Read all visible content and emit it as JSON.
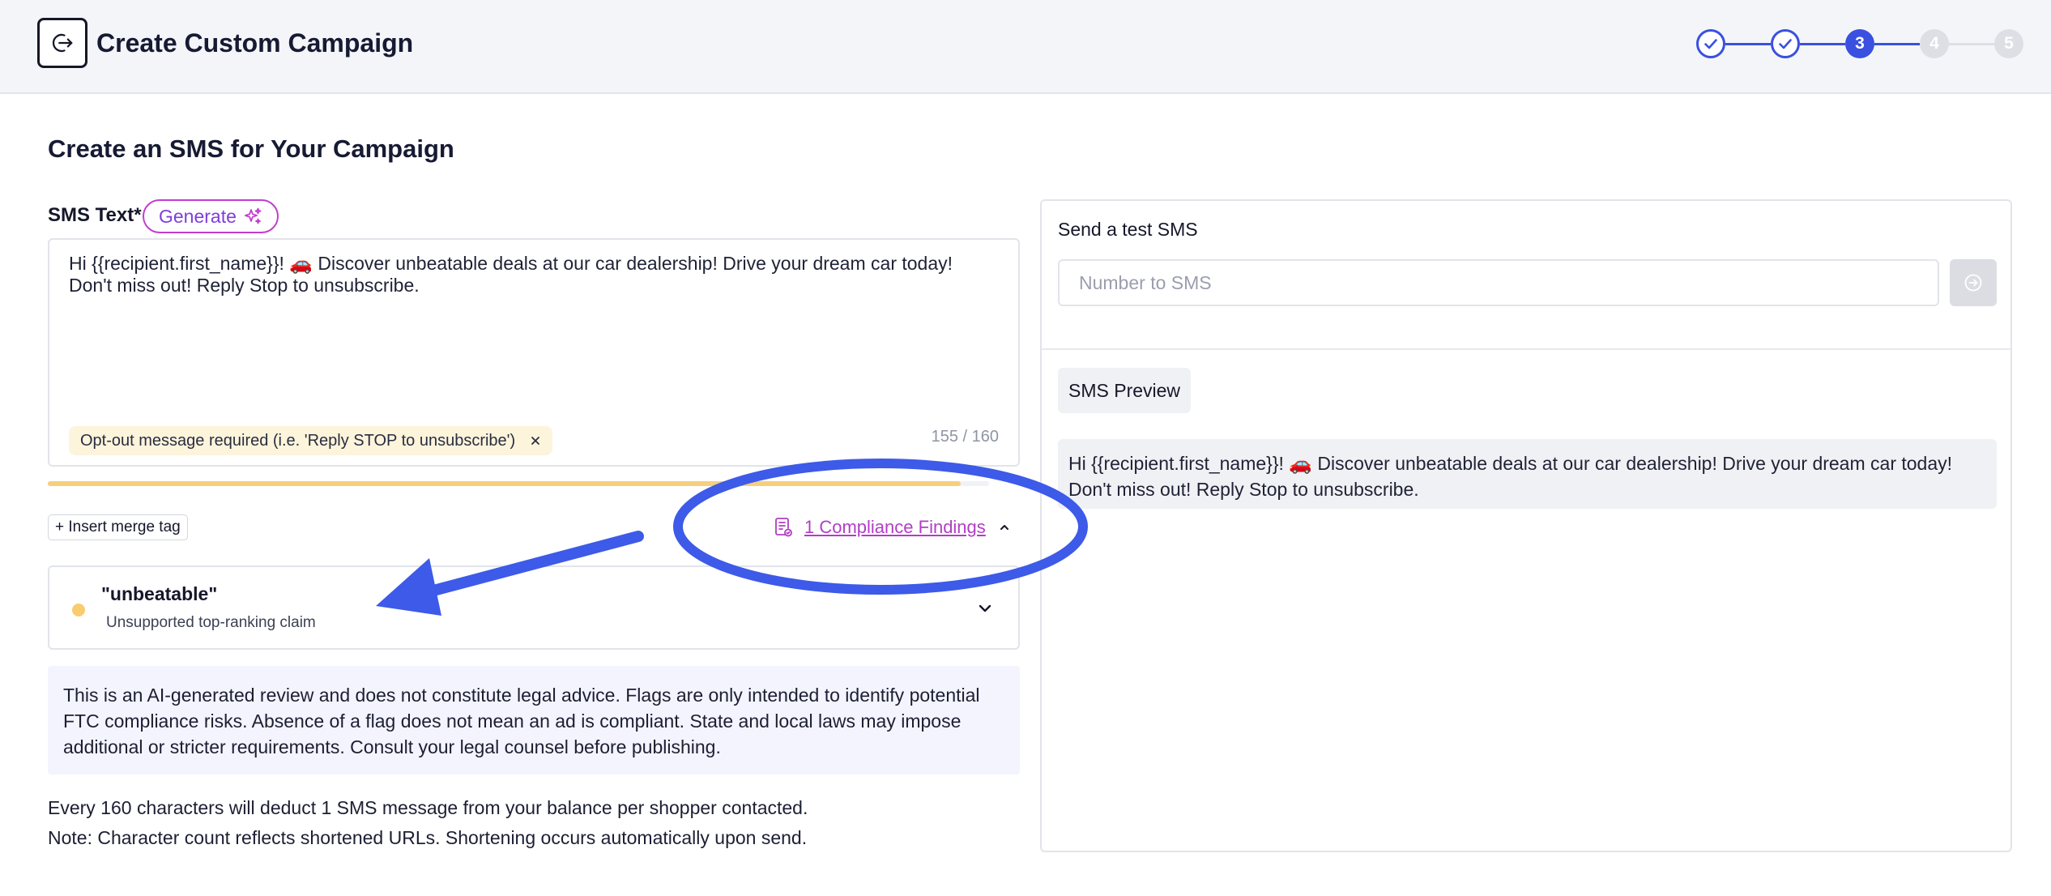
{
  "header": {
    "title": "Create Custom Campaign",
    "back_icon": "exit-arrow-icon",
    "stepper": {
      "steps": [
        {
          "label": "",
          "state": "done"
        },
        {
          "label": "",
          "state": "done"
        },
        {
          "label": "3",
          "state": "active"
        },
        {
          "label": "4",
          "state": "todo"
        },
        {
          "label": "5",
          "state": "todo"
        }
      ],
      "accent": "#3a50e0"
    }
  },
  "main": {
    "section_title": "Create an SMS for Your Campaign",
    "sms_label": "SMS Text*",
    "generate_label": "Generate",
    "sms_text": "Hi {{recipient.first_name}}! 🚗 Discover unbeatable deals at our car dealership! Drive your dream car today! Don't miss out! Reply Stop to unsubscribe.",
    "optout_warning": "Opt-out message required (i.e. 'Reply STOP to unsubscribe')",
    "char_count": "155 / 160",
    "char_progress": 0.97,
    "insert_merge_tag": "+ Insert merge tag",
    "compliance_link": "1 Compliance Findings",
    "finding": {
      "term": "\"unbeatable\"",
      "description": "Unsupported top-ranking claim",
      "severity_color": "#f8cd6f"
    },
    "disclaimer": "This is an AI-generated review and does not constitute legal advice. Flags are only intended to identify potential FTC compliance risks. Absence of a flag does not mean an ad is compliant. State and local laws may impose additional or stricter requirements. Consult your legal counsel before publishing.",
    "note_1": "Every 160 characters will deduct 1 SMS message from your balance per shopper contacted.",
    "note_2": "Note: Character count reflects shortened URLs. Shortening occurs automatically upon send."
  },
  "right_panel": {
    "test_label": "Send a test SMS",
    "number_placeholder": "Number to SMS",
    "number_value": "",
    "preview_label": "SMS Preview",
    "preview_text": "Hi {{recipient.first_name}}! 🚗 Discover unbeatable deals at our car dealership! Drive your dream car today! Don't miss out! Reply Stop to unsubscribe."
  },
  "colors": {
    "annotation_blue": "#3d5ae8",
    "compliance_purple": "#b13ec5",
    "generate_border": "#c23dcf"
  }
}
